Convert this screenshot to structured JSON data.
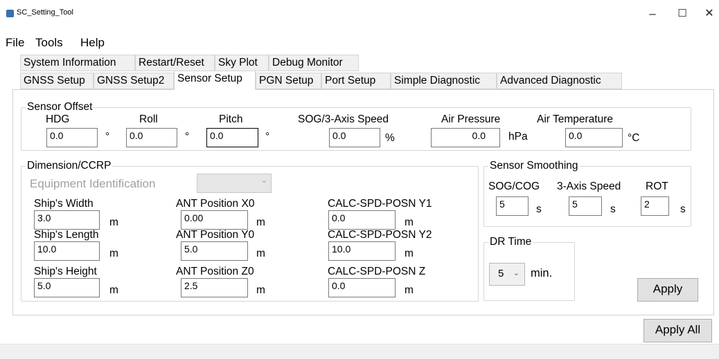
{
  "window": {
    "title": "SC_Setting_Tool",
    "app_icon": "app-icon",
    "minimize": "–",
    "maximize": "☐",
    "close": "✕"
  },
  "menu": [
    "File",
    "Tools",
    "Help"
  ],
  "tabs_row1": [
    "System Information",
    "Restart/Reset",
    "Sky Plot",
    "Debug Monitor"
  ],
  "tabs_row2": [
    "GNSS Setup",
    "GNSS Setup2",
    "Sensor Setup",
    "PGN Setup",
    "Port Setup",
    "Simple Diagnostic",
    "Advanced Diagnostic"
  ],
  "active_tab": "Sensor Setup",
  "sensor_offset": {
    "legend": "Sensor Offset",
    "hdg": {
      "label": "HDG",
      "value": "0.0",
      "unit": "°"
    },
    "roll": {
      "label": "Roll",
      "value": "0.0",
      "unit": "°"
    },
    "pitch": {
      "label": "Pitch",
      "value": "0.0",
      "unit": "°"
    },
    "sog": {
      "label": "SOG/3-Axis Speed",
      "value": "0.0",
      "unit": "%"
    },
    "air_pressure": {
      "label": "Air Pressure",
      "value": "0.0",
      "unit": "hPa"
    },
    "air_temperature": {
      "label": "Air Temperature",
      "value": "0.0",
      "unit": "°C"
    }
  },
  "dimension": {
    "legend": "Dimension/CCRP",
    "equipment_identification": "Equipment Identification",
    "ship_width": {
      "label": "Ship's Width",
      "value": "3.0",
      "unit": "m"
    },
    "ship_length": {
      "label": "Ship's Length",
      "value": "10.0",
      "unit": "m"
    },
    "ship_height": {
      "label": "Ship's Height",
      "value": "5.0",
      "unit": "m"
    },
    "ant_x0": {
      "label": "ANT Position X0",
      "value": "0.00",
      "unit": "m"
    },
    "ant_y0": {
      "label": "ANT Position Y0",
      "value": "5.0",
      "unit": "m"
    },
    "ant_z0": {
      "label": "ANT Position Z0",
      "value": "2.5",
      "unit": "m"
    },
    "calc_y1": {
      "label": "CALC-SPD-POSN Y1",
      "value": "0.0",
      "unit": "m"
    },
    "calc_y2": {
      "label": "CALC-SPD-POSN Y2",
      "value": "10.0",
      "unit": "m"
    },
    "calc_z": {
      "label": "CALC-SPD-POSN Z",
      "value": "0.0",
      "unit": "m"
    }
  },
  "smoothing": {
    "legend": "Sensor Smoothing",
    "sog_cog": {
      "label": "SOG/COG",
      "value": "5",
      "unit": "s"
    },
    "axis_speed": {
      "label": "3-Axis Speed",
      "value": "5",
      "unit": "s"
    },
    "rot": {
      "label": "ROT",
      "value": "2",
      "unit": "s"
    }
  },
  "dr_time": {
    "legend": "DR Time",
    "value": "5",
    "unit": "min."
  },
  "buttons": {
    "apply": "Apply",
    "apply_all": "Apply All"
  }
}
